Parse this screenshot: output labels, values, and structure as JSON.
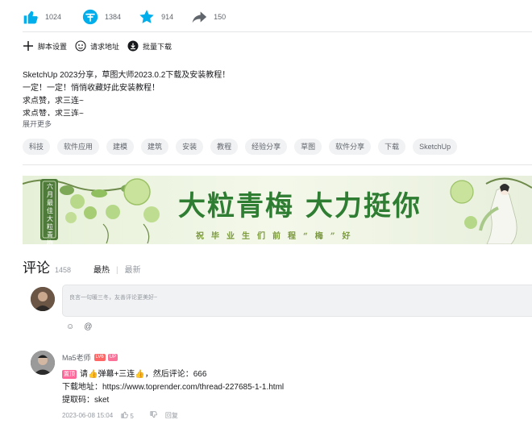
{
  "actions": {
    "like": "1024",
    "coin": "1384",
    "favorite": "914",
    "share": "150"
  },
  "tools": {
    "script_settings": "脚本设置",
    "request_url": "请求地址",
    "batch_download": "批量下载"
  },
  "description": {
    "line1": "SketchUp 2023分享，草图大师2023.0.2下载及安装教程！",
    "line2": "一定！一定！悄悄收藏好此安装教程！",
    "line3": "求点赞，求三连~",
    "line4": "求点赞，求三连~",
    "expand": "展开更多"
  },
  "tags": [
    "科技",
    "软件应用",
    "建模",
    "建筑",
    "安装",
    "教程",
    "经验分享",
    "草图",
    "软件分享",
    "下载",
    "SketchUp"
  ],
  "banner": {
    "title": "大粒青梅 大力挺你",
    "subtitle": "祝毕业生们前程“梅”好",
    "vertical": "六月最佳大粒青梅"
  },
  "comments": {
    "title": "评论",
    "count": "1458",
    "sort_hot": "最热",
    "sort_sep": "|",
    "sort_new": "最新",
    "placeholder": "良言一句暖三冬，友善评论更美好~",
    "emoji_icon": "☺",
    "at_icon": "@",
    "list": [
      {
        "user": "Ma5老师",
        "level": "LV6",
        "up_badge": "UP",
        "pin_label": "置顶",
        "text1": "请👍弹幕+三连👍，然后评论：666",
        "text2": "下载地址：https://www.toprender.com/thread-227685-1-1.html",
        "text3": "提取码：sket",
        "date": "2023-06-08 15:04",
        "likes": "5",
        "reply": "回复"
      }
    ]
  },
  "colors": {
    "accent": "#00aeec",
    "banner_green": "#2e7d32"
  }
}
